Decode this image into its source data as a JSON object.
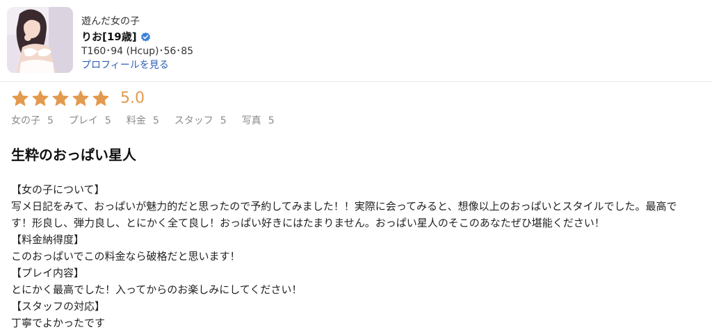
{
  "profile": {
    "tagline": "遊んだ女の子",
    "name": "りお[19歳]",
    "measurements": "T160･94 (Hcup)･56･85",
    "profile_link": "プロフィールを見る",
    "verified_icon": "verified-check-icon",
    "verified_color": "#3b82d6"
  },
  "rating": {
    "stars": 5,
    "max_stars": 5,
    "score": "5.0",
    "star_color": "#e39a4e",
    "star_icon": "star-icon"
  },
  "sub_ratings": [
    {
      "label": "女の子",
      "value": "5"
    },
    {
      "label": "プレイ",
      "value": "5"
    },
    {
      "label": "料金",
      "value": "5"
    },
    {
      "label": "スタッフ",
      "value": "5"
    },
    {
      "label": "写真",
      "value": "5"
    }
  ],
  "review": {
    "title": "生粋のおっぱい星人",
    "lines": [
      "【女の子について】",
      "写メ日記をみて、おっぱいが魅力的だと思ったので予約してみました！！実際に会ってみると、想像以上のおっぱいとスタイルでした。最高で",
      "す！形良し、弾力良し、とにかく全て良し！おっぱい好きにはたまりません。おっぱい星人のそこのあなたぜひ堪能ください！",
      "【料金納得度】",
      "このおっぱいでこの料金なら破格だと思います！",
      "【プレイ内容】",
      "とにかく最高でした！入ってからのお楽しみにしてください！",
      "【スタッフの対応】",
      "丁寧でよかったです"
    ]
  }
}
